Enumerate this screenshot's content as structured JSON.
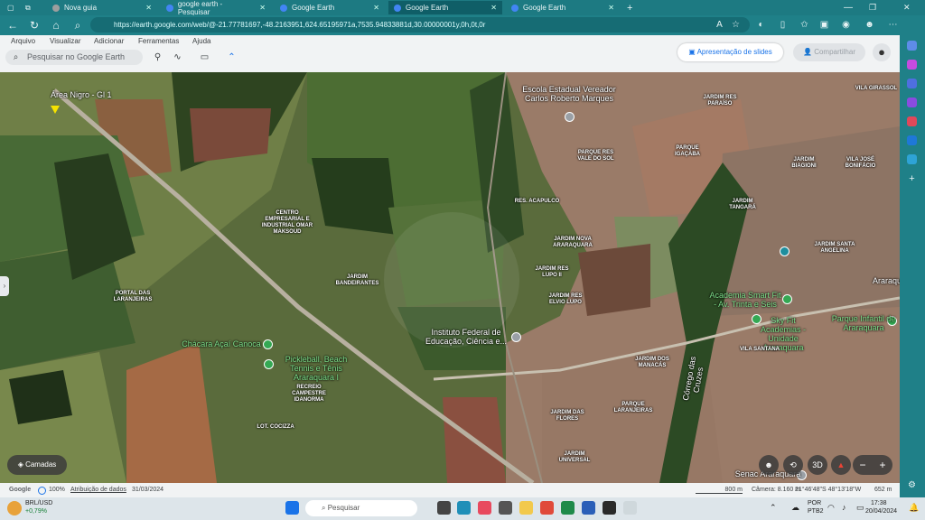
{
  "browser": {
    "tabs": [
      {
        "label": "Nova guia",
        "color": "#9e9e9e"
      },
      {
        "label": "google earth - Pesquisar",
        "color": "#4285f4"
      },
      {
        "label": "Google Earth",
        "color": "#4285f4"
      },
      {
        "label": "Google Earth",
        "color": "#4285f4"
      },
      {
        "label": "Google Earth",
        "color": "#4285f4"
      }
    ],
    "url": "https://earth.google.com/web/@-21.77781697,-48.2163951,624.65195971a,7535.94833881d,30.00000001y,0h,0t,0r"
  },
  "earth": {
    "menu": [
      "Arquivo",
      "Visualizar",
      "Adicionar",
      "Ferramentas",
      "Ajuda"
    ],
    "search_placeholder": "Pesquisar no Google Earth",
    "slides_label": "Apresentação de slides",
    "share_label": "Compartilhar",
    "layers_label": "Camadas"
  },
  "map_labels": {
    "area_nigro": "Área Nigro - Gl 1",
    "escola": "Escola Estadual Vereador Carlos Roberto Marques",
    "jardim_res_paraiso": "JARDIM RES PARAÍSO",
    "vila_girassol": "VILA GIRASSOL",
    "parque_vale_sol": "PARQUE RES VALE DO SOL",
    "parque_igacaba": "PARQUE IGAÇABA",
    "jardim_biagioni": "JARDIM BIAGIONI",
    "vila_jose_bonifacio": "VILA JOSÉ BONIFÁCIO",
    "res_acapulco": "RES. ACAPULCO",
    "centro_empresarial": "CENTRO EMPRESARIAL E INDUSTRIAL OMAR MAKSOUD",
    "jardim_tangara": "JARDIM TANGARÁ",
    "jardim_nova_araraquara": "JARDIM NOVA ARARAQUARA",
    "jardim_santa_angelina": "JARDIM SANTA ANGELINA",
    "jardim_res_lupo": "JARDIM RES LUPO II",
    "jardim_bandeirantes": "JARDIM BANDEIRANTES",
    "portal_laranjeiras": "PORTAL DAS LARANJEIRAS",
    "jardim_res_elvio_lupo": "JARDIM RES ELVIO LUPO",
    "academia_smart": "Academia Smart Fit - Av. Trinta e Seis",
    "araraquara": "Araraquara",
    "sky_fit": "Sky Fit Academias - Unidade Araraquara",
    "parque_infantil": "Parque Infantil de Araraquara",
    "instituto_federal": "Instituto Federal de Educação, Ciência e...",
    "chacara": "Chácara Açaí Canoca",
    "vila_santana": "VILA SANTANA",
    "pickleball": "Pickleball, Beach Tennis e Tênis Araraquara I",
    "jardim_manacas": "JARDIM DOS MANACÁS",
    "recreio": "RECREIO CAMPESTRE IDANORMA",
    "corrego": "Córrego das Cruzes",
    "parque_laranjeiras": "PARQUE LARANJEIRAS",
    "jardim_flores": "JARDIM DAS FLORES",
    "lot_cocizza": "LOT. COCIZZA",
    "jardim_universal": "JARDIM UNIVERSAL",
    "senac": "Senac Araraquara"
  },
  "status": {
    "google": "Google",
    "zoom": "100%",
    "attribution": "Atribuição de dados",
    "date": "31/03/2024",
    "scale": "800 m",
    "camera": "Câmera: 8.160 m",
    "coords": "21°46'48\"S 48°13'18\"W",
    "elevation": "652 m"
  },
  "taskbar": {
    "weather_ticker": "BRL/USD",
    "weather_change": "+0,79%",
    "search": "Pesquisar",
    "lang": "POR",
    "lang2": "PTB2",
    "time": "17:38",
    "date": "20/04/2024"
  }
}
